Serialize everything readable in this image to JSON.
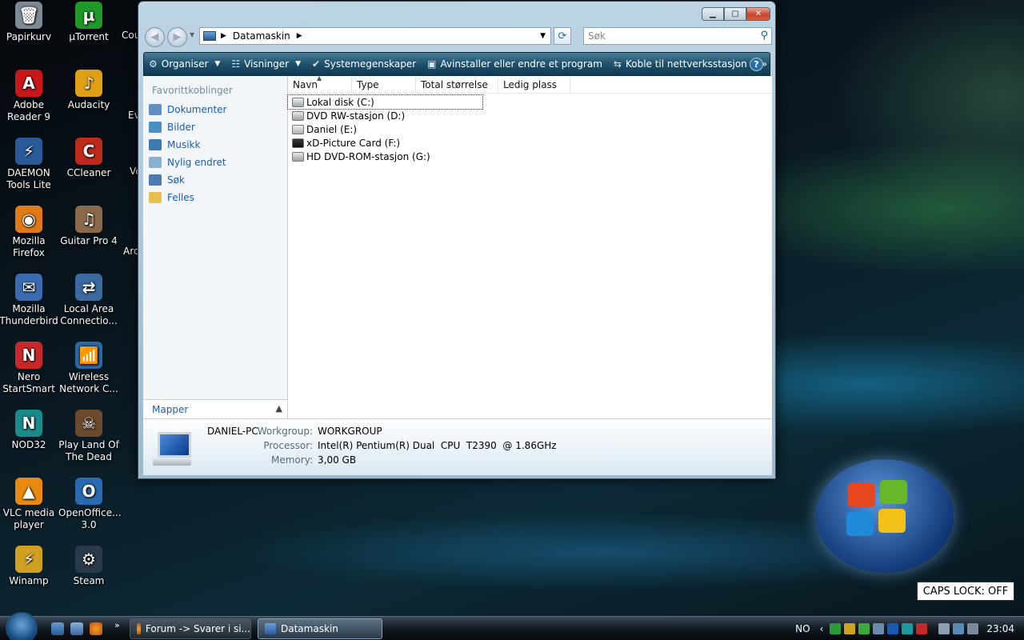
{
  "desktop": {
    "icons": [
      {
        "label": "Papirkurv",
        "col": 0,
        "row": 0,
        "icon": "recycle-bin-icon",
        "color": "#7f8a94",
        "glyph": "🗑"
      },
      {
        "label": "µTorrent",
        "col": 1,
        "row": 0,
        "icon": "utorrent-icon",
        "color": "#1f9a2a",
        "glyph": "µ"
      },
      {
        "label": "Adobe Reader 9",
        "col": 0,
        "row": 1,
        "icon": "adobe-reader-icon",
        "color": "#c8181a",
        "glyph": "A"
      },
      {
        "label": "Audacity",
        "col": 1,
        "row": 1,
        "icon": "audacity-icon",
        "color": "#e0a015",
        "glyph": "♪"
      },
      {
        "label": "DAEMON Tools Lite",
        "col": 0,
        "row": 2,
        "icon": "daemon-tools-icon",
        "color": "#2a5a9a",
        "glyph": "⚡"
      },
      {
        "label": "CCleaner",
        "col": 1,
        "row": 2,
        "icon": "ccleaner-icon",
        "color": "#c02a1a",
        "glyph": "C"
      },
      {
        "label": "Mozilla Firefox",
        "col": 0,
        "row": 3,
        "icon": "firefox-icon",
        "color": "#e07a18",
        "glyph": "◉"
      },
      {
        "label": "Guitar Pro 4",
        "col": 1,
        "row": 3,
        "icon": "guitar-pro-icon",
        "color": "#8a6a4a",
        "glyph": "♫"
      },
      {
        "label": "Mozilla Thunderbird",
        "col": 0,
        "row": 4,
        "icon": "thunderbird-icon",
        "color": "#3a6ab0",
        "glyph": "✉"
      },
      {
        "label": "Local Area Connectio...",
        "col": 1,
        "row": 4,
        "icon": "network-icon",
        "color": "#3a6aa0",
        "glyph": "⇄"
      },
      {
        "label": "Nero StartSmart",
        "col": 0,
        "row": 5,
        "icon": "nero-icon",
        "color": "#c8282a",
        "glyph": "N"
      },
      {
        "label": "Wireless Network C...",
        "col": 1,
        "row": 5,
        "icon": "wireless-network-icon",
        "color": "#2a6aa8",
        "glyph": "📶"
      },
      {
        "label": "NOD32",
        "col": 0,
        "row": 6,
        "icon": "nod32-icon",
        "color": "#1a8a8a",
        "glyph": "N"
      },
      {
        "label": "Play Land Of The Dead",
        "col": 1,
        "row": 6,
        "icon": "game-icon",
        "color": "#6a4a2a",
        "glyph": "☠"
      },
      {
        "label": "VLC media player",
        "col": 0,
        "row": 7,
        "icon": "vlc-icon",
        "color": "#e88a10",
        "glyph": "▲"
      },
      {
        "label": "OpenOffice... 3.0",
        "col": 1,
        "row": 7,
        "icon": "openoffice-icon",
        "color": "#2a6ab0",
        "glyph": "O"
      },
      {
        "label": "Winamp",
        "col": 0,
        "row": 8,
        "icon": "winamp-icon",
        "color": "#d0a020",
        "glyph": "⚡"
      },
      {
        "label": "Steam",
        "col": 1,
        "row": 8,
        "icon": "steam-icon",
        "color": "#2a3a4a",
        "glyph": "⚙"
      }
    ],
    "partial_labels": [
      "Cou",
      "Ev",
      "Ve",
      "Arc"
    ],
    "caps_lock": "CAPS LOCK: OFF"
  },
  "window": {
    "address_path": "Datamaskin",
    "search_placeholder": "Søk",
    "toolbar": [
      {
        "label": "Organiser",
        "icon": "organize-icon",
        "dropdown": true
      },
      {
        "label": "Visninger",
        "icon": "views-icon",
        "dropdown": true
      },
      {
        "label": "Systemegenskaper",
        "icon": "system-properties-icon",
        "dropdown": false
      },
      {
        "label": "Avinstaller eller endre et program",
        "icon": "uninstall-icon",
        "dropdown": false
      },
      {
        "label": "Koble til nettverksstasjon",
        "icon": "map-network-drive-icon",
        "dropdown": false
      }
    ],
    "toolbar_more": "»",
    "nav_header": "Favorittkoblinger",
    "nav_links": [
      {
        "label": "Dokumenter",
        "icon": "documents-icon",
        "color": "#5f8fc0"
      },
      {
        "label": "Bilder",
        "icon": "pictures-icon",
        "color": "#4a90c0"
      },
      {
        "label": "Musikk",
        "icon": "music-icon",
        "color": "#3a7ab0"
      },
      {
        "label": "Nylig endret",
        "icon": "recently-changed-icon",
        "color": "#8ab0d0"
      },
      {
        "label": "Søk",
        "icon": "search-folder-icon",
        "color": "#4a7ab0"
      },
      {
        "label": "Felles",
        "icon": "public-folder-icon",
        "color": "#e8c050"
      }
    ],
    "folders_label": "Mapper",
    "columns": [
      "Navn",
      "Type",
      "Total størrelse",
      "Ledig plass"
    ],
    "drives": [
      {
        "label": "Lokal disk (C:)",
        "icon": "local-disk-icon",
        "selected": true
      },
      {
        "label": "DVD RW-stasjon (D:)",
        "icon": "dvd-drive-icon",
        "selected": false
      },
      {
        "label": "Daniel (E:)",
        "icon": "removable-drive-icon",
        "selected": false
      },
      {
        "label": "xD-Picture Card (F:)",
        "icon": "xd-card-icon",
        "selected": false
      },
      {
        "label": "HD DVD-ROM-stasjon (G:)",
        "icon": "hd-dvd-icon",
        "selected": false
      }
    ],
    "details": {
      "computer_name": "DANIEL-PC",
      "workgroup_label": "Workgroup:",
      "workgroup": "WORKGROUP",
      "processor_label": "Processor:",
      "processor": "Intel(R) Pentium(R) Dual  CPU  T2390  @ 1.86GHz",
      "memory_label": "Memory:",
      "memory": "3,00 GB"
    }
  },
  "taskbar": {
    "tasks": [
      {
        "label": "Forum -> Svarer i si...",
        "icon": "firefox-icon",
        "active": false
      },
      {
        "label": "Datamaskin",
        "icon": "computer-icon",
        "active": true
      }
    ],
    "language": "NO",
    "clock": "23:04"
  }
}
